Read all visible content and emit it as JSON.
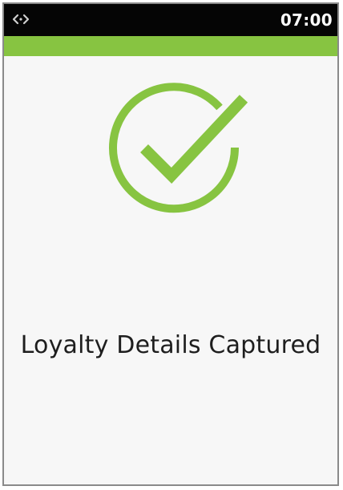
{
  "status_bar": {
    "left_icon": "transfer-arrows-icon",
    "time": "07:00"
  },
  "success": {
    "icon": "check-circle-icon",
    "message": "Loyalty Details Captured"
  },
  "colors": {
    "status_bar_background": "#050505",
    "accent": "#87c441",
    "background": "#f7f7f7",
    "text": "#1e1e1e"
  }
}
